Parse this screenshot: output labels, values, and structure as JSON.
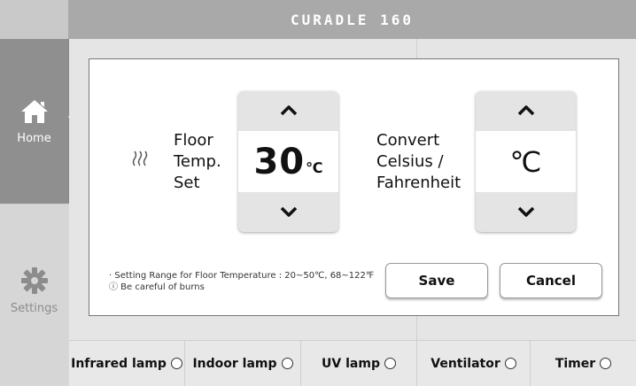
{
  "header": {
    "brand": "CURADLE 160"
  },
  "sidebar": {
    "items": [
      {
        "label": "Home",
        "icon": "home-icon",
        "active": true
      },
      {
        "label": "Settings",
        "icon": "gear-icon",
        "active": false
      }
    ]
  },
  "dialog": {
    "floor_temp": {
      "label_lines": [
        "Floor",
        "Temp.",
        "Set"
      ],
      "value": "30",
      "unit": "℃",
      "icon": "heat-waves-icon"
    },
    "unit_convert": {
      "label_lines": [
        "Convert",
        "Celsius /",
        "Fahrenheit"
      ],
      "value": "℃"
    },
    "note_range": "· Setting Range for Floor Temperature : 20~50℃, 68~122℉",
    "note_warning": "ⓘ Be careful of burns",
    "save_label": "Save",
    "cancel_label": "Cancel"
  },
  "bottom_bar": {
    "items": [
      {
        "label": "Infrared lamp",
        "checked": false
      },
      {
        "label": "Indoor lamp",
        "checked": false
      },
      {
        "label": "UV lamp",
        "checked": false
      },
      {
        "label": "Ventilator",
        "checked": false
      },
      {
        "label": "Timer",
        "checked": false
      }
    ]
  },
  "colors": {
    "sidebar_active": "#8f8f8f",
    "header": "#a9a9a9",
    "dialog_bg": "#ffffff"
  }
}
